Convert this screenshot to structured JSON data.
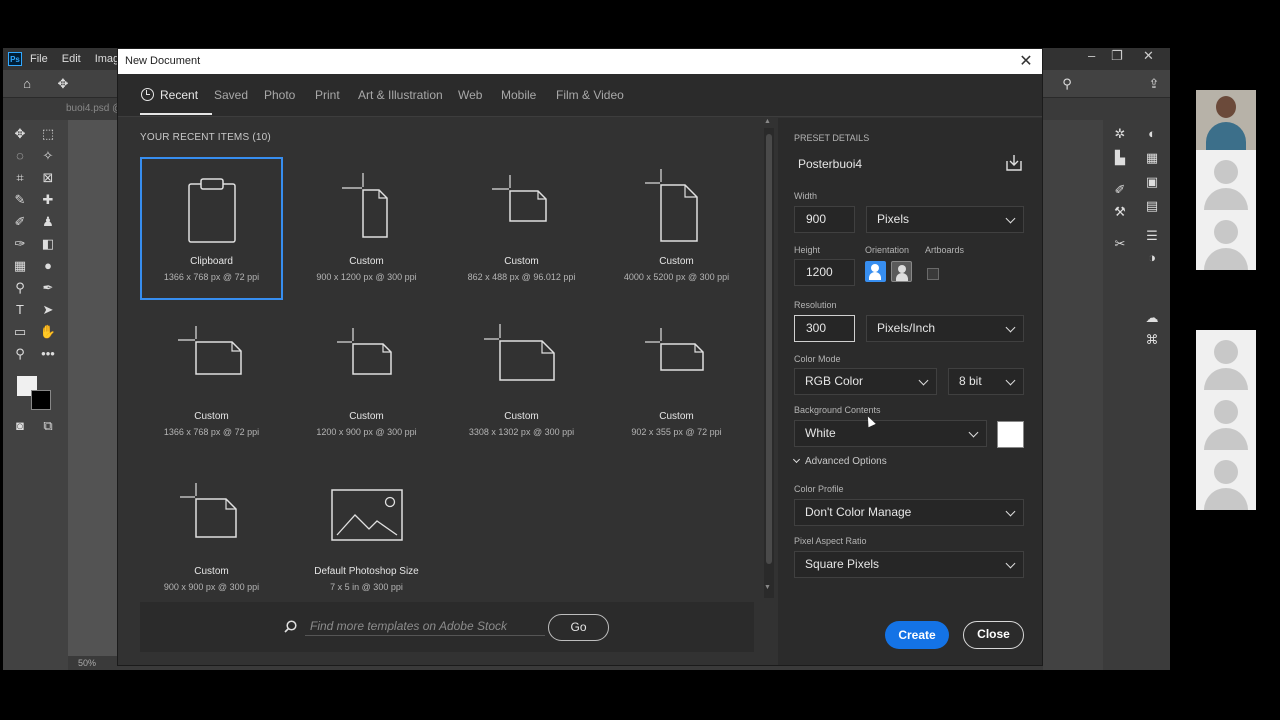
{
  "photoshop": {
    "menu": [
      "File",
      "Edit",
      "Image"
    ],
    "doc_tab": "buoi4.psd @",
    "zoom": "50%"
  },
  "dialog": {
    "title": "New Document",
    "close_icon": "close-icon",
    "tabs": [
      {
        "label": "Recent"
      },
      {
        "label": "Saved"
      },
      {
        "label": "Photo"
      },
      {
        "label": "Print"
      },
      {
        "label": "Art & Illustration"
      },
      {
        "label": "Web"
      },
      {
        "label": "Mobile"
      },
      {
        "label": "Film & Video"
      }
    ],
    "recent_heading": "YOUR RECENT ITEMS  (10)",
    "recent_items": [
      {
        "name": "Clipboard",
        "dims": "1366 x 768 px @ 72 ppi",
        "icon": "clipboard-icon"
      },
      {
        "name": "Custom",
        "dims": "900 x 1200 px @ 300 ppi",
        "icon": "custom-document-icon"
      },
      {
        "name": "Custom",
        "dims": "862 x 488 px @ 96.012 ppi",
        "icon": "custom-document-icon"
      },
      {
        "name": "Custom",
        "dims": "4000 x 5200 px @ 300 ppi",
        "icon": "custom-document-icon"
      },
      {
        "name": "Custom",
        "dims": "1366 x 768 px @ 72 ppi",
        "icon": "custom-document-icon"
      },
      {
        "name": "Custom",
        "dims": "1200 x 900 px @ 300 ppi",
        "icon": "custom-document-icon"
      },
      {
        "name": "Custom",
        "dims": "3308 x 1302 px @ 300 ppi",
        "icon": "custom-document-icon"
      },
      {
        "name": "Custom",
        "dims": "902 x 355 px @ 72 ppi",
        "icon": "custom-document-icon"
      },
      {
        "name": "Custom",
        "dims": "900 x 900 px @ 300 ppi",
        "icon": "custom-document-icon"
      },
      {
        "name": "Default Photoshop Size",
        "dims": "7 x 5 in @ 300 ppi",
        "icon": "image-icon"
      }
    ],
    "search": {
      "placeholder": "Find more templates on Adobe Stock",
      "go_label": "Go"
    },
    "preset": {
      "heading": "PRESET DETAILS",
      "name": "Posterbuoi4",
      "width_label": "Width",
      "width_value": "900",
      "width_unit": "Pixels",
      "height_label": "Height",
      "height_value": "1200",
      "orientation_label": "Orientation",
      "artboards_label": "Artboards",
      "resolution_label": "Resolution",
      "resolution_value": "300",
      "resolution_unit": "Pixels/Inch",
      "color_mode_label": "Color Mode",
      "color_mode": "RGB Color",
      "bit_depth": "8 bit",
      "background_label": "Background Contents",
      "background": "White",
      "background_swatch": "#ffffff",
      "advanced_label": "Advanced Options",
      "color_profile_label": "Color Profile",
      "color_profile": "Don't Color Manage",
      "pixel_aspect_label": "Pixel Aspect Ratio",
      "pixel_aspect": "Square Pixels"
    },
    "create_label": "Create",
    "close_label": "Close"
  },
  "colors": {
    "accent": "#1473e6",
    "selection": "#378ef0"
  }
}
